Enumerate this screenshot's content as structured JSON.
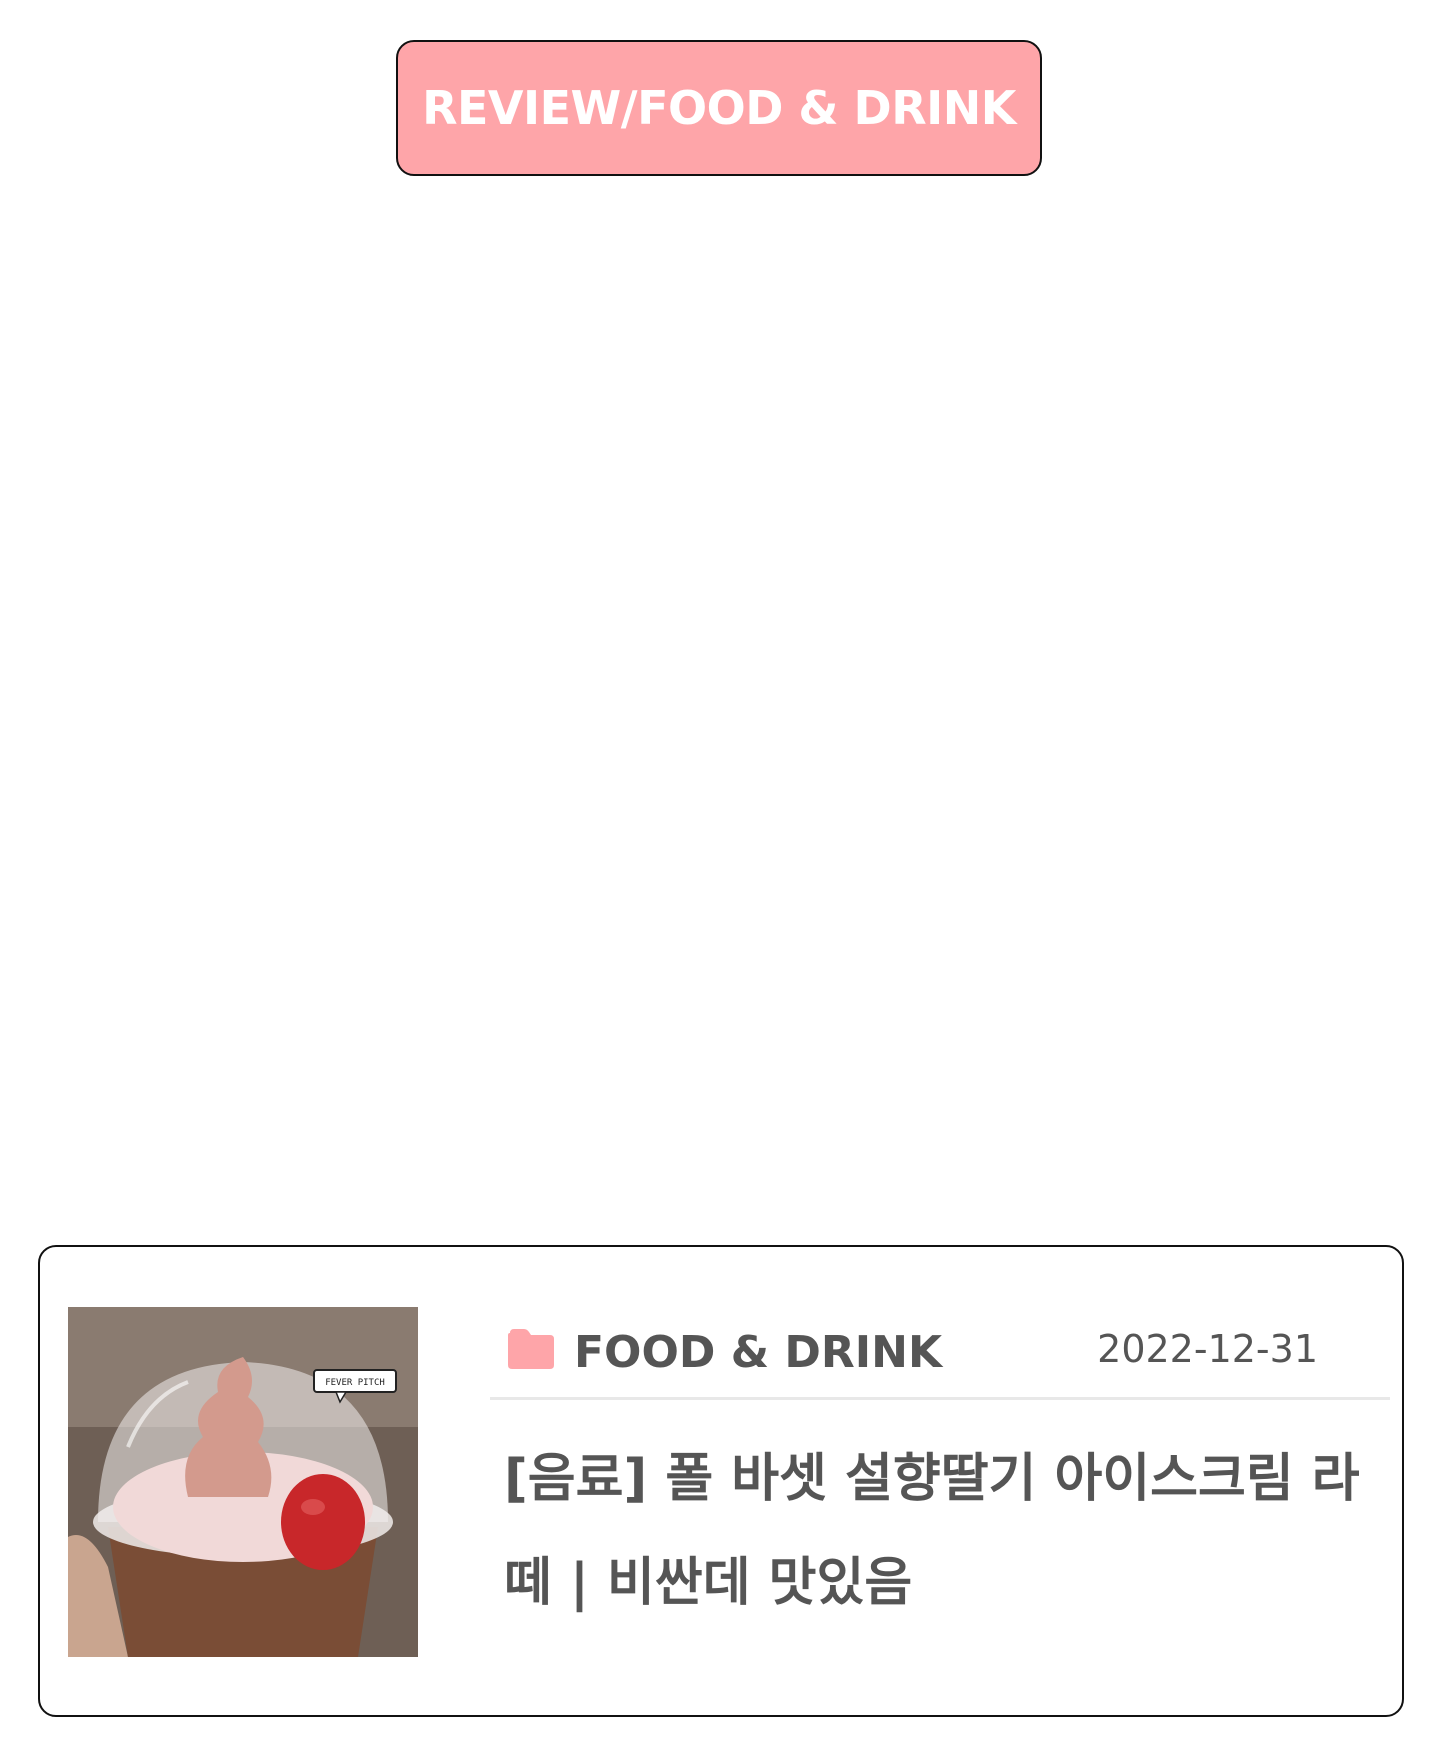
{
  "header": {
    "category_path": "REVIEW/FOOD & DRINK",
    "bg_color": "#fea5a9",
    "text_color": "#ffffff"
  },
  "post": {
    "category": "FOOD & DRINK",
    "category_icon": "folder-icon",
    "date": "2022-12-31",
    "title": "[음료] 폴 바셋 설향딸기 아이스크림 라떼 | 비싼데 맛있음",
    "thumbnail_caption": "FEVER PITCH",
    "accent_color": "#fea5a9",
    "text_color": "#555555"
  }
}
